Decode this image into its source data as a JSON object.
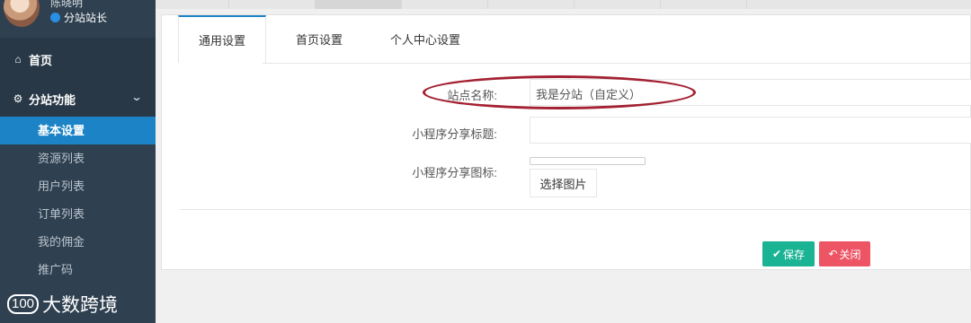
{
  "sidebar": {
    "profile": {
      "name": "陈晓明",
      "role": "分站站长"
    },
    "nav": {
      "home": "首页",
      "function": "分站功能"
    },
    "items": [
      {
        "label": "基本设置",
        "active": true
      },
      {
        "label": "资源列表"
      },
      {
        "label": "用户列表"
      },
      {
        "label": "订单列表"
      },
      {
        "label": "我的佣金"
      },
      {
        "label": "推广码"
      }
    ],
    "brand": "大数跨境",
    "brand_logo": "100"
  },
  "tabs": [
    {
      "label": "通用设置",
      "active": true
    },
    {
      "label": "首页设置"
    },
    {
      "label": "个人中心设置"
    }
  ],
  "form": {
    "site_name_label": "站点名称:",
    "site_name_value": "我是分站（自定义）",
    "share_title_label": "小程序分享标题:",
    "share_title_value": "",
    "share_icon_label": "小程序分享图标:",
    "pick_image": "选择图片"
  },
  "actions": {
    "save": "保存",
    "close": "关闭"
  },
  "colors": {
    "sidebar": "#2f4050",
    "active": "#1c84c6",
    "save": "#1ab394",
    "close": "#ed5565",
    "highlight": "#a32132"
  }
}
